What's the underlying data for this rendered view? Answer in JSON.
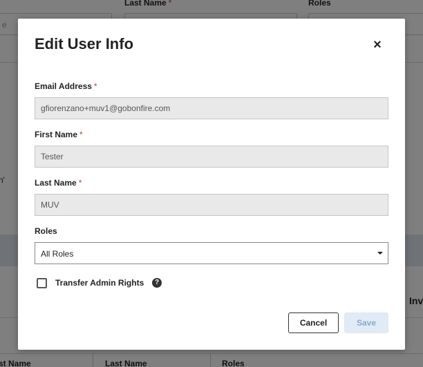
{
  "background": {
    "top_labels": {
      "last_name": "Last Name",
      "roles": "Roles"
    },
    "first_input_fragment": "e",
    "side_fragment": "n'",
    "inv_fragment": "Inv",
    "bottom_columns": {
      "first_name": "st Name",
      "last_name": "Last Name",
      "roles": "Roles"
    }
  },
  "modal": {
    "title": "Edit User Info",
    "close_glyph": "×",
    "required_marker": "*",
    "email": {
      "label": "Email Address",
      "value": "gfiorenzano+muv1@gobonfire.com"
    },
    "first_name": {
      "label": "First Name",
      "value": "Tester"
    },
    "last_name": {
      "label": "Last Name",
      "value": "MUV"
    },
    "roles": {
      "label": "Roles",
      "selected": "All Roles"
    },
    "transfer_admin": {
      "label": "Transfer Admin Rights",
      "checked": false,
      "help_glyph": "?"
    },
    "buttons": {
      "cancel": "Cancel",
      "save": "Save"
    }
  },
  "colors": {
    "required": "#c0392b",
    "save_disabled_bg": "#e1ebf6",
    "save_disabled_text": "#8aa9cc",
    "overlay": "rgba(0,0,0,0.5)"
  },
  "icons": {
    "close": "close-icon",
    "caret": "chevron-down-icon",
    "help": "help-circle-icon"
  }
}
